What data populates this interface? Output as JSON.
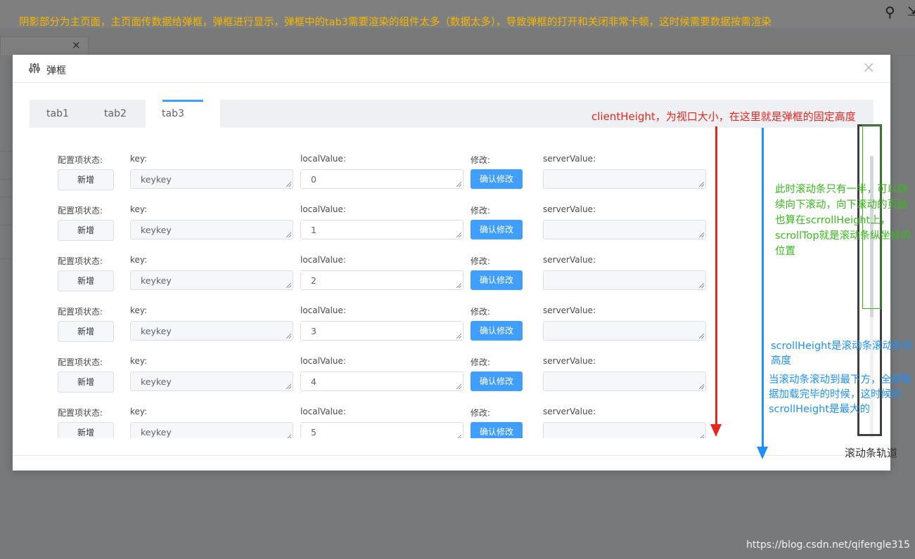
{
  "annotations": {
    "top_note": "阴影部分为主页面，主页面传数据给弹框，弹框进行显示，弹框中的tab3需要渲染的组件太多（数据太多），导致弹框的打开和关闭非常卡顿，这时候需要数据按需渲染",
    "client_height": "clientHeight，为视口大小，在这里就是弹框的固定高度",
    "scroll_top": "此时滚动条只有一半，可以继续向下滚动，向下滚动的页面也算在scrrollHeight上，scrollTop就是滚动条纵坐标的位置",
    "scroll_height": "scrollHeight是滚动条滚动的总高度",
    "scroll_height_max": "当滚动条滚动到最下方，全部数据加载完毕的时候，这时候的scrollHeight是最大的",
    "track_label": "滚动条轨道"
  },
  "background": {
    "tab_close": "×"
  },
  "dialog": {
    "title": "弹框",
    "close": "×",
    "tabs": [
      "tab1",
      "tab2",
      "tab3"
    ],
    "active_tab": "tab3",
    "labels": {
      "status": "配置项状态:",
      "key": "key:",
      "local": "localValue:",
      "modify": "修改:",
      "server": "serverValue:"
    },
    "rows": [
      {
        "status_btn": "新增",
        "key": "keykey",
        "local": "0",
        "confirm": "确认修改",
        "server": ""
      },
      {
        "status_btn": "新增",
        "key": "keykey",
        "local": "1",
        "confirm": "确认修改",
        "server": ""
      },
      {
        "status_btn": "新增",
        "key": "keykey",
        "local": "2",
        "confirm": "确认修改",
        "server": ""
      },
      {
        "status_btn": "新增",
        "key": "keykey",
        "local": "3",
        "confirm": "确认修改",
        "server": ""
      },
      {
        "status_btn": "新增",
        "key": "keykey",
        "local": "4",
        "confirm": "确认修改",
        "server": ""
      },
      {
        "status_btn": "新增",
        "key": "keykey",
        "local": "5",
        "confirm": "确认修改",
        "server": ""
      }
    ]
  },
  "watermark": "https://blog.csdn.net/qifengle315",
  "colors": {
    "primary": "#409eff",
    "note_yellow": "#f5b800",
    "note_red": "#e8261d",
    "note_green": "#3ab81c",
    "note_blue": "#1e90ff"
  }
}
